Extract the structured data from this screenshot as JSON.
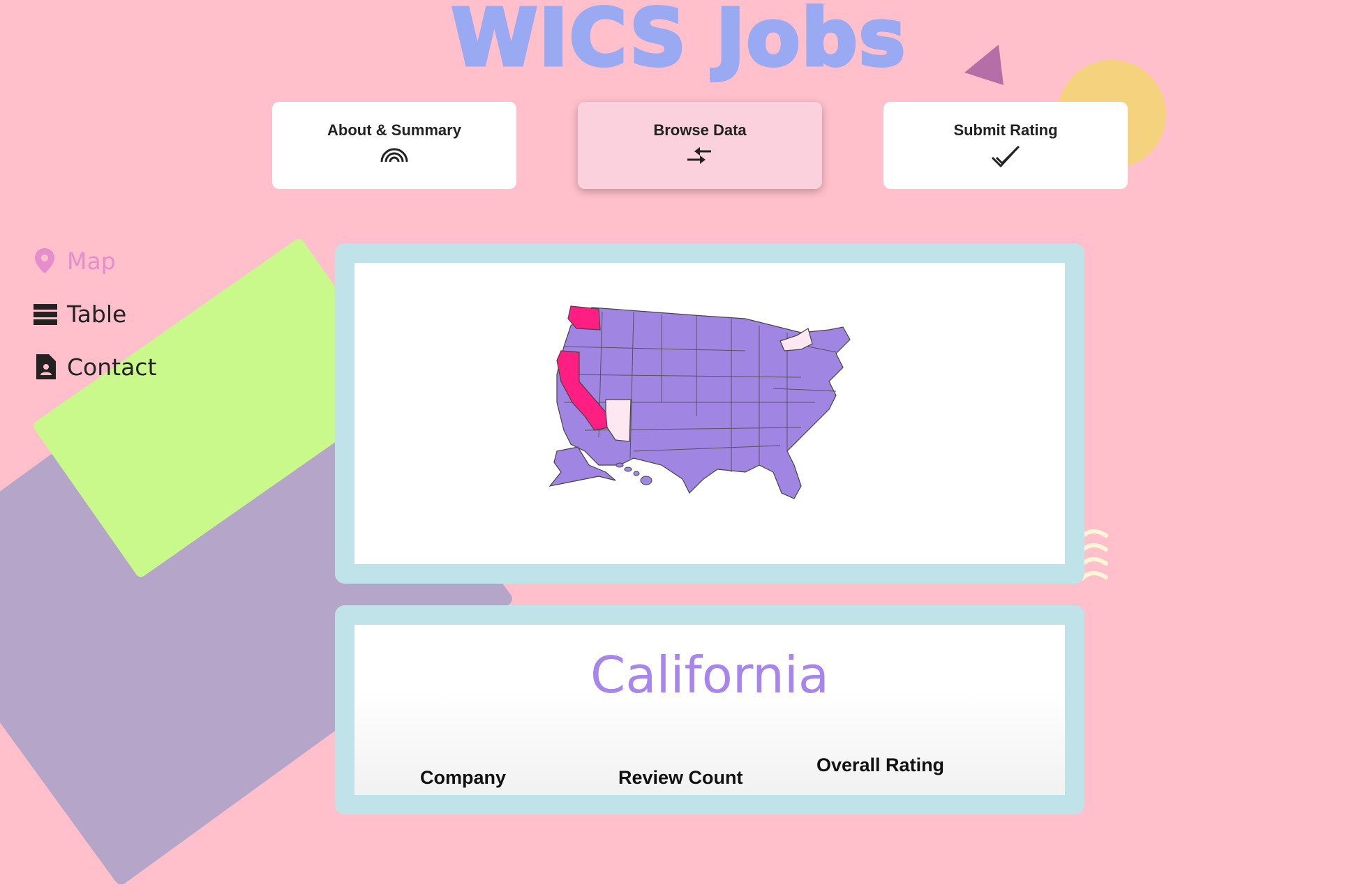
{
  "site": {
    "title": "WICS Jobs"
  },
  "top_nav": [
    {
      "label": "About & Summary",
      "icon": "rainbow-icon",
      "active": false
    },
    {
      "label": "Browse Data",
      "icon": "compare-arrows-icon",
      "active": true
    },
    {
      "label": "Submit Rating",
      "icon": "double-check-icon",
      "active": false
    }
  ],
  "side_nav": [
    {
      "label": "Map",
      "icon": "map-pin-icon",
      "active": true
    },
    {
      "label": "Table",
      "icon": "table-rows-icon",
      "active": false
    },
    {
      "label": "Contact",
      "icon": "contact-file-icon",
      "active": false
    }
  ],
  "map": {
    "selected_state": "California",
    "highlight_colors": {
      "default": "#a185e3",
      "high": "#ff1e82",
      "low": "#fde7f0"
    }
  },
  "detail": {
    "state_name": "California",
    "columns": [
      "Company",
      "Review Count",
      "Overall Rating"
    ]
  },
  "colors": {
    "background": "#ffc0cb",
    "title": "#99aaf3",
    "panel_border": "#bfe3e8",
    "accent_purple": "#a785ec",
    "active_side": "#e48fcb"
  }
}
